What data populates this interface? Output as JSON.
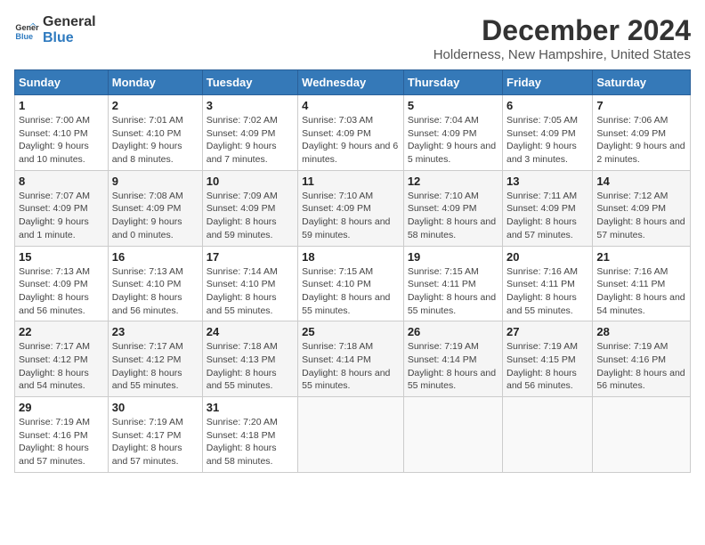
{
  "header": {
    "logo_line1": "General",
    "logo_line2": "Blue",
    "month": "December 2024",
    "location": "Holderness, New Hampshire, United States"
  },
  "weekdays": [
    "Sunday",
    "Monday",
    "Tuesday",
    "Wednesday",
    "Thursday",
    "Friday",
    "Saturday"
  ],
  "weeks": [
    [
      {
        "day": "1",
        "sunrise": "7:00 AM",
        "sunset": "4:10 PM",
        "daylight": "9 hours and 10 minutes."
      },
      {
        "day": "2",
        "sunrise": "7:01 AM",
        "sunset": "4:10 PM",
        "daylight": "9 hours and 8 minutes."
      },
      {
        "day": "3",
        "sunrise": "7:02 AM",
        "sunset": "4:09 PM",
        "daylight": "9 hours and 7 minutes."
      },
      {
        "day": "4",
        "sunrise": "7:03 AM",
        "sunset": "4:09 PM",
        "daylight": "9 hours and 6 minutes."
      },
      {
        "day": "5",
        "sunrise": "7:04 AM",
        "sunset": "4:09 PM",
        "daylight": "9 hours and 5 minutes."
      },
      {
        "day": "6",
        "sunrise": "7:05 AM",
        "sunset": "4:09 PM",
        "daylight": "9 hours and 3 minutes."
      },
      {
        "day": "7",
        "sunrise": "7:06 AM",
        "sunset": "4:09 PM",
        "daylight": "9 hours and 2 minutes."
      }
    ],
    [
      {
        "day": "8",
        "sunrise": "7:07 AM",
        "sunset": "4:09 PM",
        "daylight": "9 hours and 1 minute."
      },
      {
        "day": "9",
        "sunrise": "7:08 AM",
        "sunset": "4:09 PM",
        "daylight": "9 hours and 0 minutes."
      },
      {
        "day": "10",
        "sunrise": "7:09 AM",
        "sunset": "4:09 PM",
        "daylight": "8 hours and 59 minutes."
      },
      {
        "day": "11",
        "sunrise": "7:10 AM",
        "sunset": "4:09 PM",
        "daylight": "8 hours and 59 minutes."
      },
      {
        "day": "12",
        "sunrise": "7:10 AM",
        "sunset": "4:09 PM",
        "daylight": "8 hours and 58 minutes."
      },
      {
        "day": "13",
        "sunrise": "7:11 AM",
        "sunset": "4:09 PM",
        "daylight": "8 hours and 57 minutes."
      },
      {
        "day": "14",
        "sunrise": "7:12 AM",
        "sunset": "4:09 PM",
        "daylight": "8 hours and 57 minutes."
      }
    ],
    [
      {
        "day": "15",
        "sunrise": "7:13 AM",
        "sunset": "4:09 PM",
        "daylight": "8 hours and 56 minutes."
      },
      {
        "day": "16",
        "sunrise": "7:13 AM",
        "sunset": "4:10 PM",
        "daylight": "8 hours and 56 minutes."
      },
      {
        "day": "17",
        "sunrise": "7:14 AM",
        "sunset": "4:10 PM",
        "daylight": "8 hours and 55 minutes."
      },
      {
        "day": "18",
        "sunrise": "7:15 AM",
        "sunset": "4:10 PM",
        "daylight": "8 hours and 55 minutes."
      },
      {
        "day": "19",
        "sunrise": "7:15 AM",
        "sunset": "4:11 PM",
        "daylight": "8 hours and 55 minutes."
      },
      {
        "day": "20",
        "sunrise": "7:16 AM",
        "sunset": "4:11 PM",
        "daylight": "8 hours and 55 minutes."
      },
      {
        "day": "21",
        "sunrise": "7:16 AM",
        "sunset": "4:11 PM",
        "daylight": "8 hours and 54 minutes."
      }
    ],
    [
      {
        "day": "22",
        "sunrise": "7:17 AM",
        "sunset": "4:12 PM",
        "daylight": "8 hours and 54 minutes."
      },
      {
        "day": "23",
        "sunrise": "7:17 AM",
        "sunset": "4:12 PM",
        "daylight": "8 hours and 55 minutes."
      },
      {
        "day": "24",
        "sunrise": "7:18 AM",
        "sunset": "4:13 PM",
        "daylight": "8 hours and 55 minutes."
      },
      {
        "day": "25",
        "sunrise": "7:18 AM",
        "sunset": "4:14 PM",
        "daylight": "8 hours and 55 minutes."
      },
      {
        "day": "26",
        "sunrise": "7:19 AM",
        "sunset": "4:14 PM",
        "daylight": "8 hours and 55 minutes."
      },
      {
        "day": "27",
        "sunrise": "7:19 AM",
        "sunset": "4:15 PM",
        "daylight": "8 hours and 56 minutes."
      },
      {
        "day": "28",
        "sunrise": "7:19 AM",
        "sunset": "4:16 PM",
        "daylight": "8 hours and 56 minutes."
      }
    ],
    [
      {
        "day": "29",
        "sunrise": "7:19 AM",
        "sunset": "4:16 PM",
        "daylight": "8 hours and 57 minutes."
      },
      {
        "day": "30",
        "sunrise": "7:19 AM",
        "sunset": "4:17 PM",
        "daylight": "8 hours and 57 minutes."
      },
      {
        "day": "31",
        "sunrise": "7:20 AM",
        "sunset": "4:18 PM",
        "daylight": "8 hours and 58 minutes."
      },
      null,
      null,
      null,
      null
    ]
  ],
  "labels": {
    "sunrise": "Sunrise:",
    "sunset": "Sunset:",
    "daylight": "Daylight:"
  }
}
